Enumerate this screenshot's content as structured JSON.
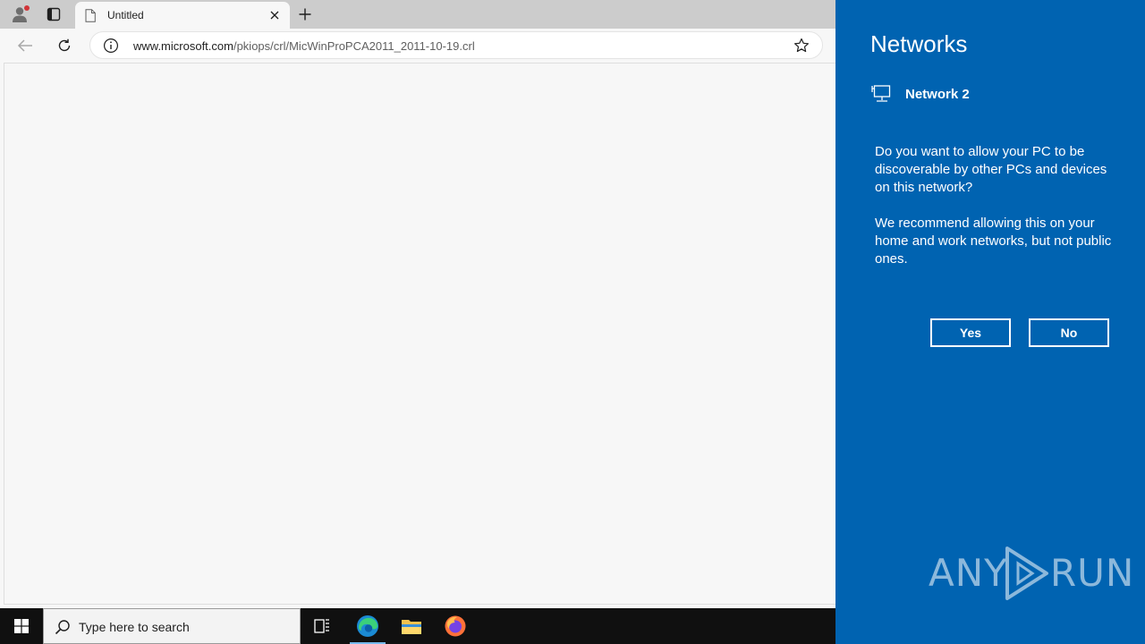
{
  "browser": {
    "tab": {
      "title": "Untitled"
    },
    "address": {
      "host": "www.microsoft.com",
      "path": "/pkiops/crl/MicWinProPCA2011_2011-10-19.crl"
    }
  },
  "taskbar": {
    "search_placeholder": "Type here to search"
  },
  "flyout": {
    "title": "Networks",
    "network_name": "Network 2",
    "question": "Do you want to allow your PC to be discoverable by other PCs and devices on this network?",
    "recommendation": "We recommend allowing this on your home and work networks, but not public ones.",
    "yes_label": "Yes",
    "no_label": "No",
    "watermark": {
      "left": "ANY",
      "right": "RUN"
    }
  },
  "colors": {
    "flyout_bg": "#0063b1",
    "taskbar_bg": "#101010",
    "profile_badge": "#d13438"
  }
}
